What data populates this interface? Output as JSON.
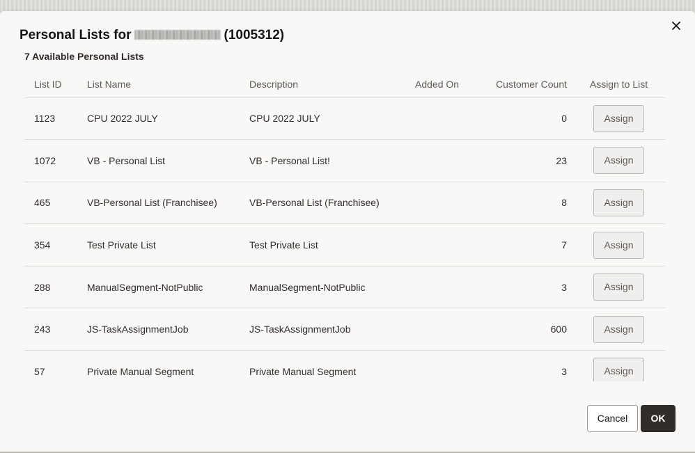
{
  "dialog": {
    "title_prefix": "Personal Lists for",
    "title_suffix": "(1005312)",
    "close_icon": "close-icon",
    "subtitle": "7 Available Personal Lists"
  },
  "table": {
    "columns": [
      "List ID",
      "List Name",
      "Description",
      "Added On",
      "Customer Count",
      "Assign to List"
    ],
    "rows": [
      {
        "id": "1123",
        "name": "CPU 2022 JULY",
        "description": "CPU 2022 JULY",
        "added_on": "",
        "count": "0",
        "action": "Assign"
      },
      {
        "id": "1072",
        "name": "VB - Personal List",
        "description": "VB - Personal List!",
        "added_on": "",
        "count": "23",
        "action": "Assign"
      },
      {
        "id": "465",
        "name": "VB-Personal List (Franchisee)",
        "description": "VB-Personal List (Franchisee)",
        "added_on": "",
        "count": "8",
        "action": "Assign"
      },
      {
        "id": "354",
        "name": "Test Private List",
        "description": "Test Private List",
        "added_on": "",
        "count": "7",
        "action": "Assign"
      },
      {
        "id": "288",
        "name": "ManualSegment-NotPublic",
        "description": "ManualSegment-NotPublic",
        "added_on": "",
        "count": "3",
        "action": "Assign"
      },
      {
        "id": "243",
        "name": "JS-TaskAssignmentJob",
        "description": "JS-TaskAssignmentJob",
        "added_on": "",
        "count": "600",
        "action": "Assign"
      },
      {
        "id": "57",
        "name": "Private Manual Segment",
        "description": "Private Manual Segment",
        "added_on": "",
        "count": "3",
        "action": "Assign"
      }
    ]
  },
  "footer": {
    "cancel_label": "Cancel",
    "ok_label": "OK"
  },
  "colors": {
    "dialog_bg": "#f9f8f6",
    "primary_button": "#312d2a",
    "border": "#e0ddd8"
  }
}
